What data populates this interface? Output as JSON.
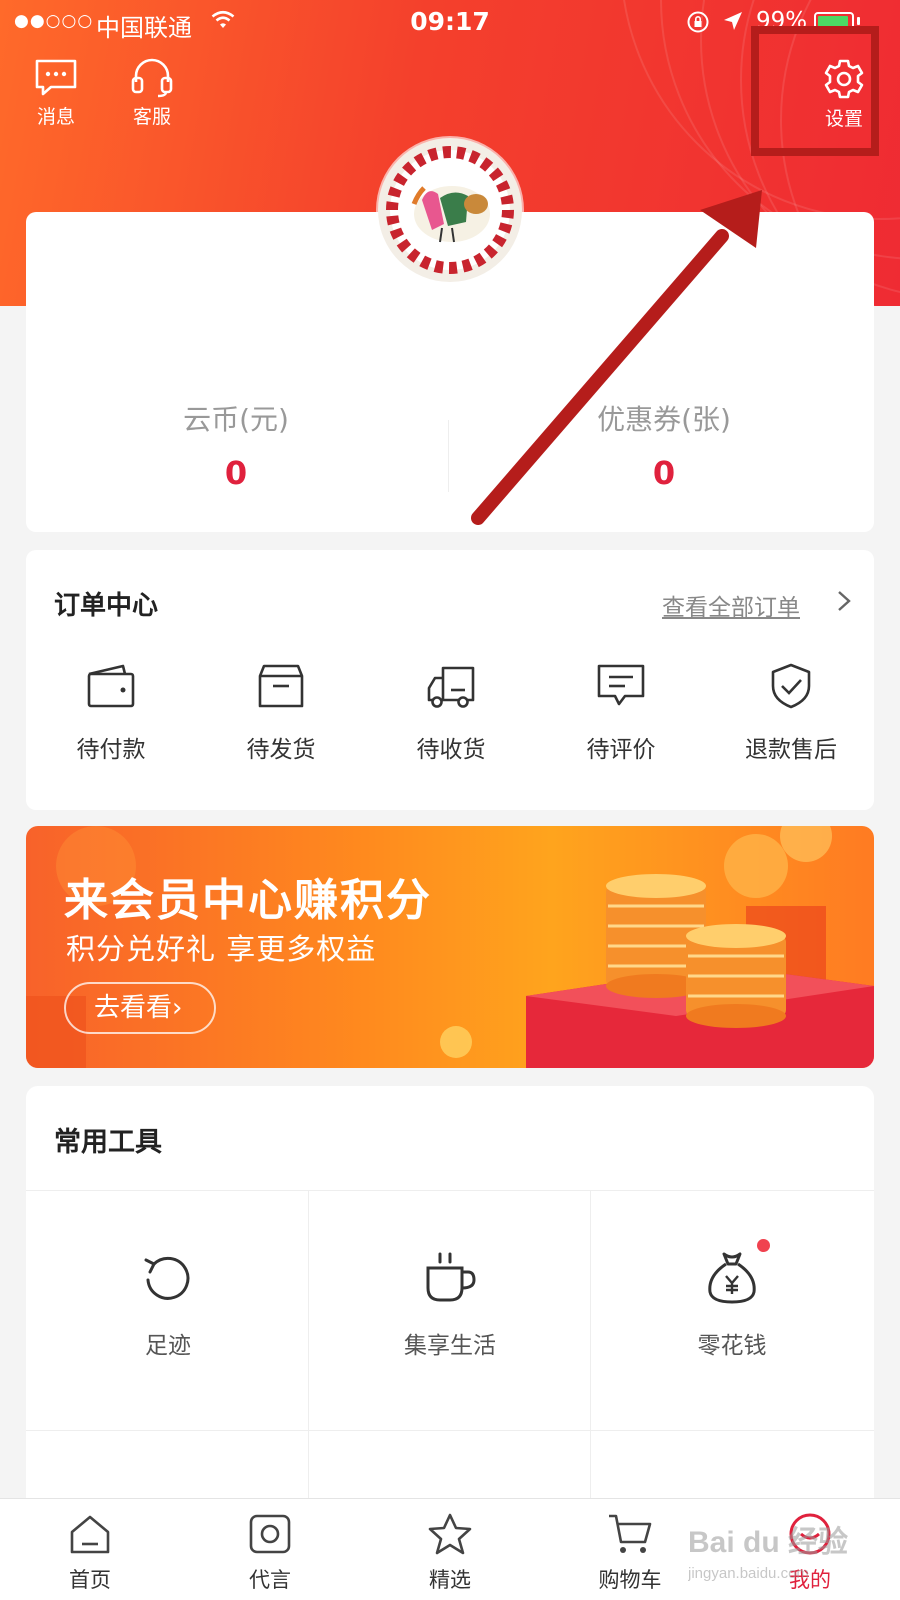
{
  "status_bar": {
    "signal": "●●○○○",
    "carrier": "中国联通",
    "time": "09:17",
    "battery": "99%"
  },
  "header": {
    "messages_label": "消息",
    "service_label": "客服",
    "settings_label": "设置"
  },
  "account": {
    "coins_label": "云币(元)",
    "coins_value": "0",
    "coupons_label": "优惠券(张)",
    "coupons_value": "0"
  },
  "orders": {
    "title": "订单中心",
    "view_all": "查看全部订单",
    "items": [
      {
        "label": "待付款",
        "icon": "wallet-icon"
      },
      {
        "label": "待发货",
        "icon": "box-icon"
      },
      {
        "label": "待收货",
        "icon": "truck-icon"
      },
      {
        "label": "待评价",
        "icon": "comment-icon"
      },
      {
        "label": "退款售后",
        "icon": "shield-check-icon"
      }
    ]
  },
  "banner": {
    "title": "来会员中心赚积分",
    "subtitle": "积分兑好礼  享更多权益",
    "button": "去看看›"
  },
  "tools": {
    "title": "常用工具",
    "items": [
      {
        "label": "足迹",
        "icon": "history-icon"
      },
      {
        "label": "集享生活",
        "icon": "cup-icon"
      },
      {
        "label": "零花钱",
        "icon": "money-bag-icon"
      }
    ]
  },
  "tabbar": {
    "active": "我的",
    "items": [
      {
        "label": "首页",
        "icon": "home-icon"
      },
      {
        "label": "代言",
        "icon": "camera-icon"
      },
      {
        "label": "精选",
        "icon": "star-icon"
      },
      {
        "label": "购物车",
        "icon": "cart-icon"
      },
      {
        "label": "我的",
        "icon": "profile-icon"
      }
    ]
  },
  "watermark": {
    "brand": "Bai du 经验",
    "url": "jingyan.baidu.com"
  },
  "colors": {
    "header_gradient_start": "#ff6a2a",
    "header_gradient_end": "#ef2b33",
    "accent_red": "#e0213d",
    "highlight_box": "#b51d1b"
  }
}
